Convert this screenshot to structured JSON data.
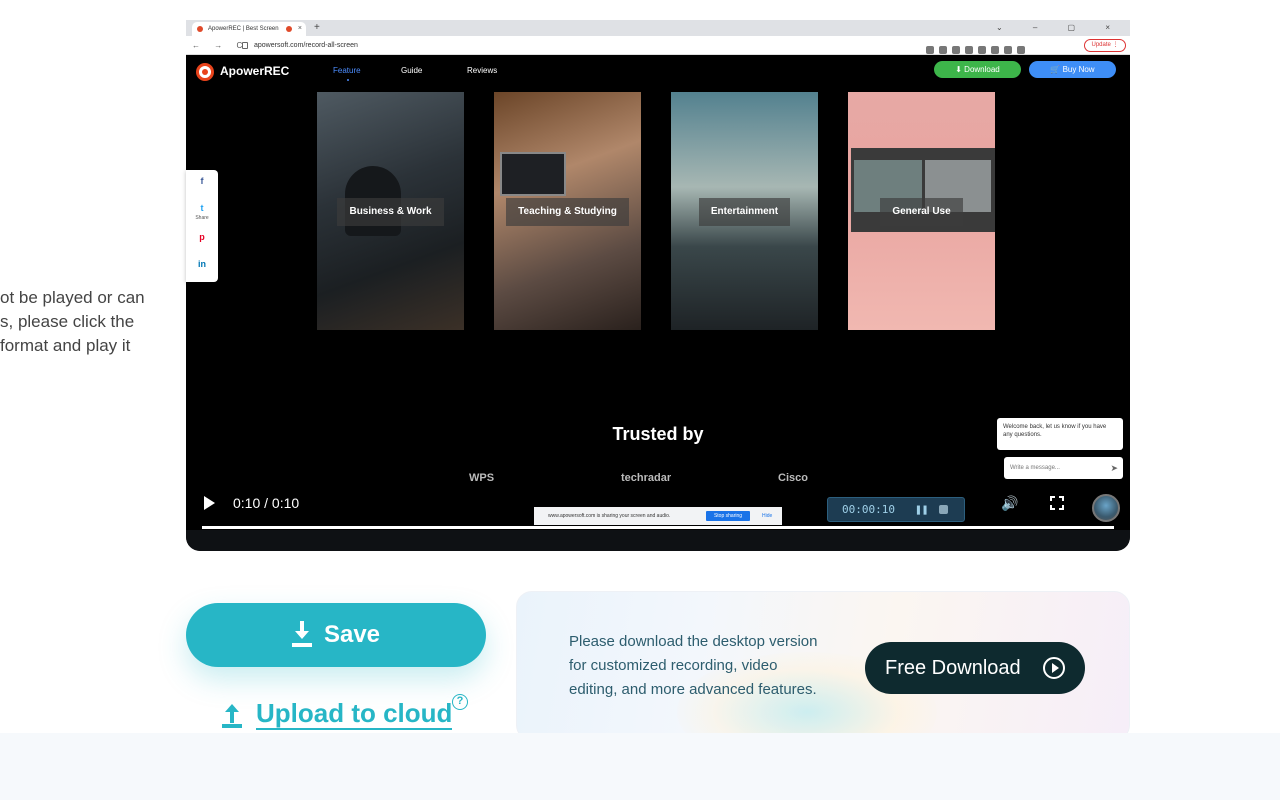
{
  "left_text": [
    "ot be played or can",
    "s, please click the",
    " format and play it"
  ],
  "browser": {
    "tab_title": "ApowerREC | Best Screen",
    "tab_close": "×",
    "new_tab": "+",
    "window_controls": "⌄ – ▢ ×",
    "nav_icons": "← → C",
    "url": "apowersoft.com/record-all-screen",
    "update_label": "Update ⋮"
  },
  "site": {
    "logo": "ApowerREC",
    "nav": [
      "Feature",
      "Guide",
      "Reviews"
    ],
    "download_label": "⬇ Download",
    "buy_label": "🛒 Buy Now"
  },
  "cards": [
    "Business & Work",
    "Teaching & Studying",
    "Entertainment",
    "General Use"
  ],
  "trusted": {
    "title": "Trusted by",
    "brands": [
      "WPS",
      "techradar",
      "Cisco"
    ]
  },
  "chat": {
    "bubble": "Welcome back, let us know if you have any questions.",
    "input_placeholder": "Write a message...",
    "send": "➤"
  },
  "player": {
    "time": "0:10 / 0:10",
    "rec_timer": "00:00:10",
    "rec_pause": "❚❚",
    "volume": "🔊",
    "progress": 1.0
  },
  "share_banner": {
    "text": "www.apowersoft.com is sharing your screen and audio.",
    "stop": "Stop sharing",
    "hide": "Hide"
  },
  "social": {
    "facebook": "f",
    "twitter": "t",
    "share_label": "Share",
    "pinterest": "p",
    "linkedin": "in"
  },
  "actions": {
    "save": "Save",
    "upload": "Upload to cloud",
    "help": "?"
  },
  "promo": {
    "text": "Please download the desktop version for customized recording, video editing, and more advanced features.",
    "button": "Free Download"
  },
  "colors": {
    "accent": "#27b6c6",
    "dark_button": "#0e2a2f",
    "site_download": "#3db54a",
    "site_buy": "#3e8ef7"
  }
}
